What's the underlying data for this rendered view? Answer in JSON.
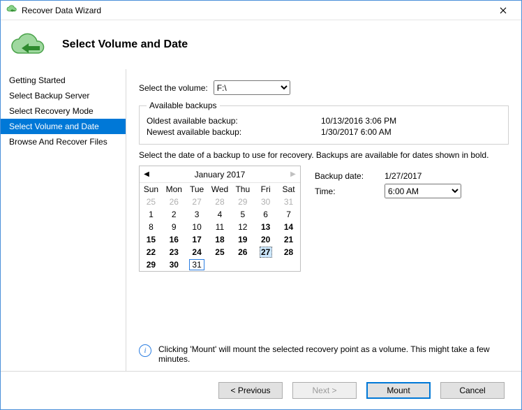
{
  "window": {
    "title": "Recover Data Wizard"
  },
  "header": {
    "heading": "Select Volume and Date"
  },
  "sidebar": {
    "items": [
      {
        "label": "Getting Started"
      },
      {
        "label": "Select Backup Server"
      },
      {
        "label": "Select Recovery Mode"
      },
      {
        "label": "Select Volume and Date"
      },
      {
        "label": "Browse And Recover Files"
      }
    ],
    "selected_index": 3
  },
  "volume": {
    "label": "Select the volume:",
    "value": "F:\\",
    "options": [
      "F:\\"
    ]
  },
  "available": {
    "legend": "Available backups",
    "oldest_label": "Oldest available backup:",
    "oldest_value": "10/13/2016 3:06 PM",
    "newest_label": "Newest available backup:",
    "newest_value": "1/30/2017 6:00 AM"
  },
  "instruction": "Select the date of a backup to use for recovery. Backups are available for dates shown in bold.",
  "calendar": {
    "title": "January 2017",
    "dow": [
      "Sun",
      "Mon",
      "Tue",
      "Wed",
      "Thu",
      "Fri",
      "Sat"
    ],
    "weeks": [
      [
        {
          "n": 25,
          "other": true
        },
        {
          "n": 26,
          "other": true
        },
        {
          "n": 27,
          "other": true
        },
        {
          "n": 28,
          "other": true
        },
        {
          "n": 29,
          "other": true
        },
        {
          "n": 30,
          "other": true
        },
        {
          "n": 31,
          "other": true
        }
      ],
      [
        {
          "n": 1
        },
        {
          "n": 2
        },
        {
          "n": 3
        },
        {
          "n": 4
        },
        {
          "n": 5
        },
        {
          "n": 6
        },
        {
          "n": 7
        }
      ],
      [
        {
          "n": 8
        },
        {
          "n": 9
        },
        {
          "n": 10
        },
        {
          "n": 11
        },
        {
          "n": 12
        },
        {
          "n": 13,
          "bold": true
        },
        {
          "n": 14,
          "bold": true
        }
      ],
      [
        {
          "n": 15,
          "bold": true
        },
        {
          "n": 16,
          "bold": true
        },
        {
          "n": 17,
          "bold": true
        },
        {
          "n": 18,
          "bold": true
        },
        {
          "n": 19,
          "bold": true
        },
        {
          "n": 20,
          "bold": true
        },
        {
          "n": 21,
          "bold": true
        }
      ],
      [
        {
          "n": 22,
          "bold": true
        },
        {
          "n": 23,
          "bold": true
        },
        {
          "n": 24,
          "bold": true
        },
        {
          "n": 25,
          "bold": true
        },
        {
          "n": 26,
          "bold": true
        },
        {
          "n": 27,
          "bold": true,
          "selected": true
        },
        {
          "n": 28,
          "bold": true
        }
      ],
      [
        {
          "n": 29,
          "bold": true
        },
        {
          "n": 30,
          "bold": true
        },
        {
          "n": 31,
          "today": true
        },
        {
          "n": ""
        },
        {
          "n": ""
        },
        {
          "n": ""
        },
        {
          "n": ""
        }
      ]
    ]
  },
  "backup_date": {
    "label": "Backup date:",
    "value": "1/27/2017"
  },
  "time": {
    "label": "Time:",
    "value": "6:00 AM",
    "options": [
      "6:00 AM"
    ]
  },
  "note": "Clicking 'Mount' will mount the selected recovery point as a volume. This might take a few minutes.",
  "buttons": {
    "previous": "< Previous",
    "next": "Next >",
    "mount": "Mount",
    "cancel": "Cancel"
  }
}
